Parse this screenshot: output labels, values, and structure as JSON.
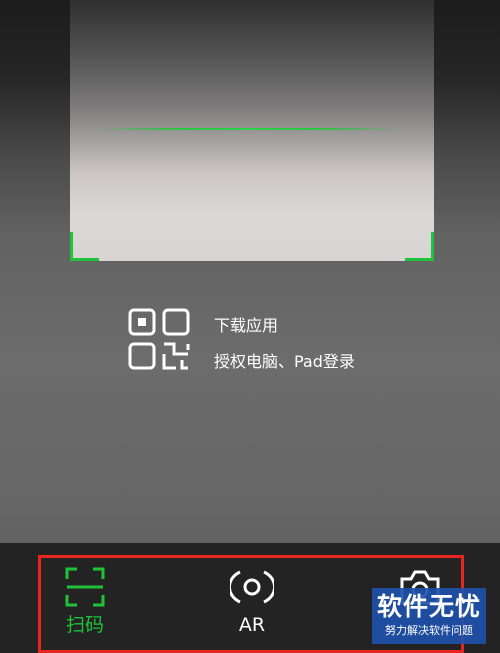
{
  "scanner": {
    "accent_color": "#1fc33a",
    "hint_icon": "qr-code-icon",
    "hint_line1": "下载应用",
    "hint_line2": "授权电脑、Pad登录"
  },
  "toolbar": {
    "highlight_color": "#e8251f",
    "tabs": [
      {
        "id": "scan",
        "label": "扫码",
        "icon": "scan-frame-icon",
        "active": true
      },
      {
        "id": "ar",
        "label": "AR",
        "icon": "ar-target-icon",
        "active": false
      },
      {
        "id": "photo",
        "label": "",
        "icon": "camera-icon",
        "active": false
      }
    ]
  },
  "watermark": {
    "title": "软件无忧",
    "subtitle": "努力解决软件问题"
  }
}
